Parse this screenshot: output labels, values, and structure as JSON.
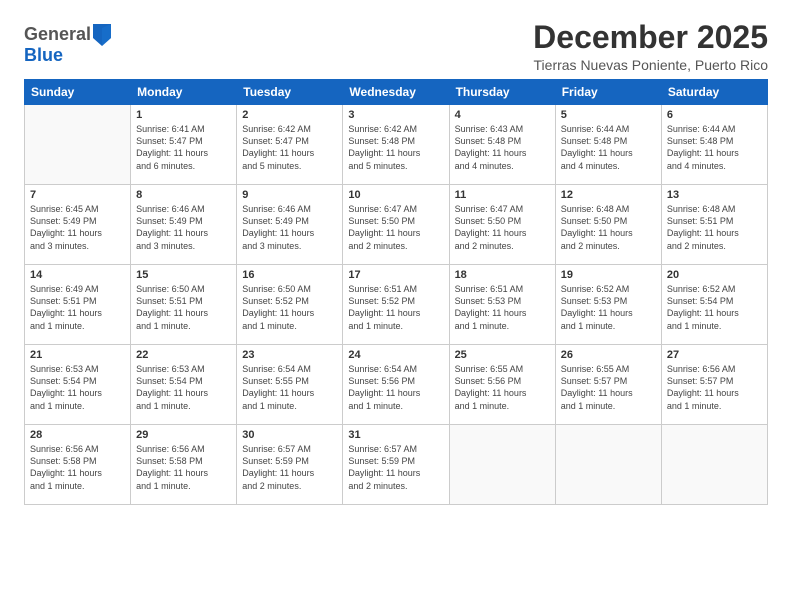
{
  "header": {
    "logo_general": "General",
    "logo_blue": "Blue",
    "month": "December 2025",
    "location": "Tierras Nuevas Poniente, Puerto Rico"
  },
  "weekdays": [
    "Sunday",
    "Monday",
    "Tuesday",
    "Wednesday",
    "Thursday",
    "Friday",
    "Saturday"
  ],
  "weeks": [
    [
      {
        "day": "",
        "info": ""
      },
      {
        "day": "1",
        "info": "Sunrise: 6:41 AM\nSunset: 5:47 PM\nDaylight: 11 hours\nand 6 minutes."
      },
      {
        "day": "2",
        "info": "Sunrise: 6:42 AM\nSunset: 5:47 PM\nDaylight: 11 hours\nand 5 minutes."
      },
      {
        "day": "3",
        "info": "Sunrise: 6:42 AM\nSunset: 5:48 PM\nDaylight: 11 hours\nand 5 minutes."
      },
      {
        "day": "4",
        "info": "Sunrise: 6:43 AM\nSunset: 5:48 PM\nDaylight: 11 hours\nand 4 minutes."
      },
      {
        "day": "5",
        "info": "Sunrise: 6:44 AM\nSunset: 5:48 PM\nDaylight: 11 hours\nand 4 minutes."
      },
      {
        "day": "6",
        "info": "Sunrise: 6:44 AM\nSunset: 5:48 PM\nDaylight: 11 hours\nand 4 minutes."
      }
    ],
    [
      {
        "day": "7",
        "info": "Sunrise: 6:45 AM\nSunset: 5:49 PM\nDaylight: 11 hours\nand 3 minutes."
      },
      {
        "day": "8",
        "info": "Sunrise: 6:46 AM\nSunset: 5:49 PM\nDaylight: 11 hours\nand 3 minutes."
      },
      {
        "day": "9",
        "info": "Sunrise: 6:46 AM\nSunset: 5:49 PM\nDaylight: 11 hours\nand 3 minutes."
      },
      {
        "day": "10",
        "info": "Sunrise: 6:47 AM\nSunset: 5:50 PM\nDaylight: 11 hours\nand 2 minutes."
      },
      {
        "day": "11",
        "info": "Sunrise: 6:47 AM\nSunset: 5:50 PM\nDaylight: 11 hours\nand 2 minutes."
      },
      {
        "day": "12",
        "info": "Sunrise: 6:48 AM\nSunset: 5:50 PM\nDaylight: 11 hours\nand 2 minutes."
      },
      {
        "day": "13",
        "info": "Sunrise: 6:48 AM\nSunset: 5:51 PM\nDaylight: 11 hours\nand 2 minutes."
      }
    ],
    [
      {
        "day": "14",
        "info": "Sunrise: 6:49 AM\nSunset: 5:51 PM\nDaylight: 11 hours\nand 1 minute."
      },
      {
        "day": "15",
        "info": "Sunrise: 6:50 AM\nSunset: 5:51 PM\nDaylight: 11 hours\nand 1 minute."
      },
      {
        "day": "16",
        "info": "Sunrise: 6:50 AM\nSunset: 5:52 PM\nDaylight: 11 hours\nand 1 minute."
      },
      {
        "day": "17",
        "info": "Sunrise: 6:51 AM\nSunset: 5:52 PM\nDaylight: 11 hours\nand 1 minute."
      },
      {
        "day": "18",
        "info": "Sunrise: 6:51 AM\nSunset: 5:53 PM\nDaylight: 11 hours\nand 1 minute."
      },
      {
        "day": "19",
        "info": "Sunrise: 6:52 AM\nSunset: 5:53 PM\nDaylight: 11 hours\nand 1 minute."
      },
      {
        "day": "20",
        "info": "Sunrise: 6:52 AM\nSunset: 5:54 PM\nDaylight: 11 hours\nand 1 minute."
      }
    ],
    [
      {
        "day": "21",
        "info": "Sunrise: 6:53 AM\nSunset: 5:54 PM\nDaylight: 11 hours\nand 1 minute."
      },
      {
        "day": "22",
        "info": "Sunrise: 6:53 AM\nSunset: 5:54 PM\nDaylight: 11 hours\nand 1 minute."
      },
      {
        "day": "23",
        "info": "Sunrise: 6:54 AM\nSunset: 5:55 PM\nDaylight: 11 hours\nand 1 minute."
      },
      {
        "day": "24",
        "info": "Sunrise: 6:54 AM\nSunset: 5:56 PM\nDaylight: 11 hours\nand 1 minute."
      },
      {
        "day": "25",
        "info": "Sunrise: 6:55 AM\nSunset: 5:56 PM\nDaylight: 11 hours\nand 1 minute."
      },
      {
        "day": "26",
        "info": "Sunrise: 6:55 AM\nSunset: 5:57 PM\nDaylight: 11 hours\nand 1 minute."
      },
      {
        "day": "27",
        "info": "Sunrise: 6:56 AM\nSunset: 5:57 PM\nDaylight: 11 hours\nand 1 minute."
      }
    ],
    [
      {
        "day": "28",
        "info": "Sunrise: 6:56 AM\nSunset: 5:58 PM\nDaylight: 11 hours\nand 1 minute."
      },
      {
        "day": "29",
        "info": "Sunrise: 6:56 AM\nSunset: 5:58 PM\nDaylight: 11 hours\nand 1 minute."
      },
      {
        "day": "30",
        "info": "Sunrise: 6:57 AM\nSunset: 5:59 PM\nDaylight: 11 hours\nand 2 minutes."
      },
      {
        "day": "31",
        "info": "Sunrise: 6:57 AM\nSunset: 5:59 PM\nDaylight: 11 hours\nand 2 minutes."
      },
      {
        "day": "",
        "info": ""
      },
      {
        "day": "",
        "info": ""
      },
      {
        "day": "",
        "info": ""
      }
    ]
  ]
}
